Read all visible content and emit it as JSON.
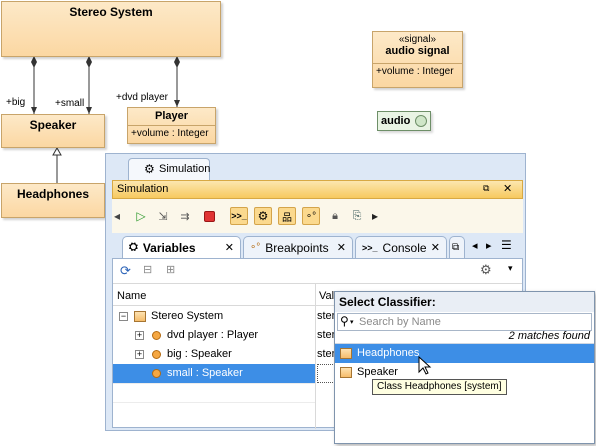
{
  "diagram": {
    "stereo_system": "Stereo System",
    "speaker": "Speaker",
    "headphones": "Headphones",
    "player": "Player",
    "player_attr": "+volume : Integer",
    "signal_stereotype": "«signal»",
    "signal_name": "audio signal",
    "signal_attr": "+volume : Integer",
    "port_label": "audio",
    "role_big": "+big",
    "role_small": "+small",
    "role_dvd": "+dvd player"
  },
  "window": {
    "tab_label": "Simulation",
    "title": "Simulation"
  },
  "subtabs": [
    {
      "label": "Variables"
    },
    {
      "label": "Breakpoints"
    },
    {
      "label": "Console"
    }
  ],
  "table": {
    "col_name": "Name",
    "col_value": "Val",
    "rows": [
      {
        "name": "Stereo System",
        "value": "ster"
      },
      {
        "name": "dvd player : Player",
        "value": "ster"
      },
      {
        "name": "big : Speaker",
        "value": "ster"
      },
      {
        "name": "small : Speaker",
        "value": ""
      }
    ]
  },
  "popup": {
    "title": "Select Classifier:",
    "search_placeholder": "Search by Name",
    "matches": "2 matches found",
    "items": [
      {
        "label": "Headphones"
      },
      {
        "label": "Speaker"
      }
    ],
    "tooltip": "Class Headphones [system]"
  },
  "colors": {
    "accent_header": "#f7c95f",
    "selection": "#3d8ee6",
    "uml_fill": "#fbd7a2"
  }
}
